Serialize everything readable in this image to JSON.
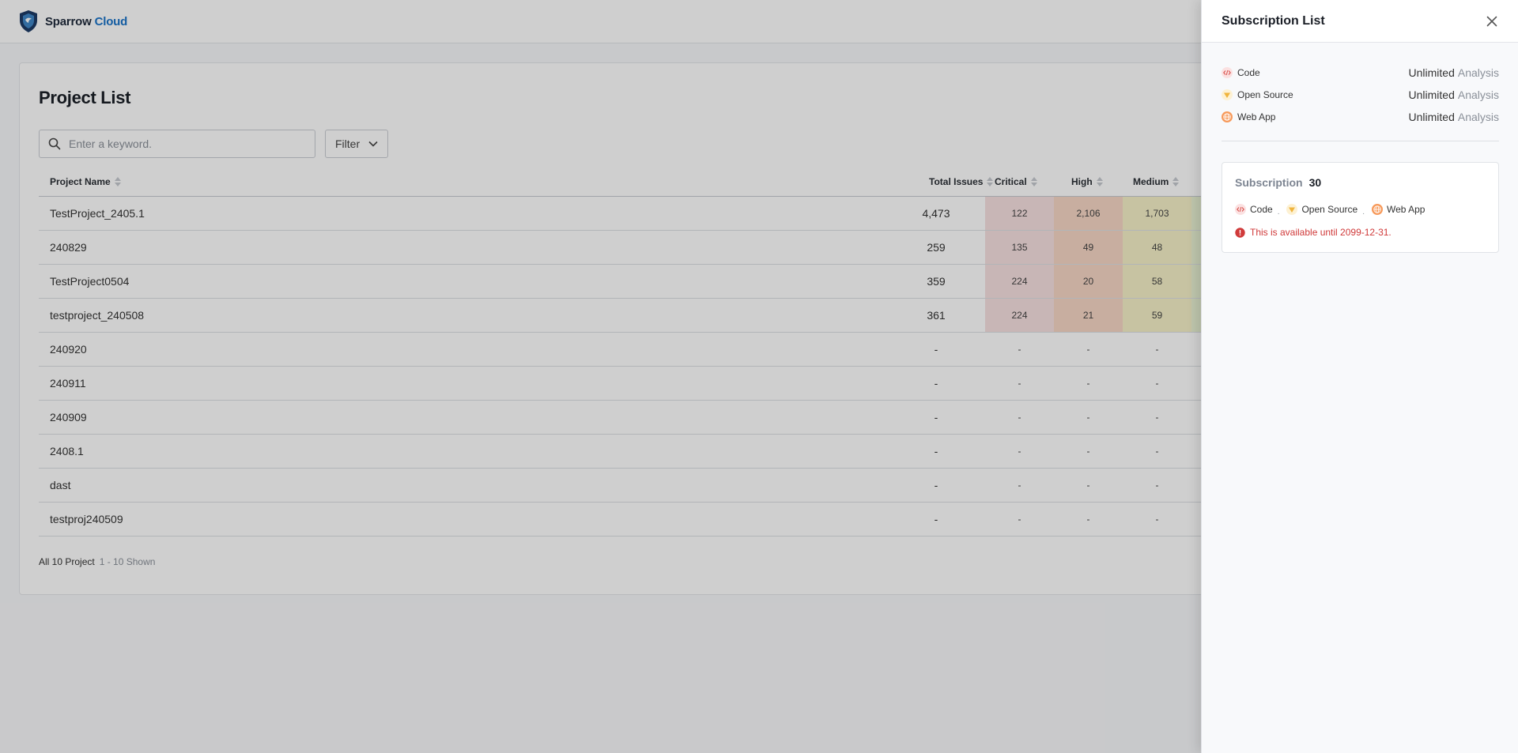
{
  "app": {
    "brand_main": "Sparrow",
    "brand_accent": "Cloud",
    "brand_color": "#1a73c8"
  },
  "project_list": {
    "title": "Project List",
    "search_placeholder": "Enter a keyword.",
    "filter_label": "Filter",
    "columns": {
      "name": "Project Name",
      "total": "Total Issues",
      "critical": "Critical",
      "high": "High",
      "medium": "Medium"
    },
    "rows": [
      {
        "name": "TestProject_2405.1",
        "total": "4,473",
        "critical": "122",
        "high": "2,106",
        "medium": "1,703",
        "has_data": true
      },
      {
        "name": "240829",
        "total": "259",
        "critical": "135",
        "high": "49",
        "medium": "48",
        "has_data": true
      },
      {
        "name": "TestProject0504",
        "total": "359",
        "critical": "224",
        "high": "20",
        "medium": "58",
        "has_data": true
      },
      {
        "name": "testproject_240508",
        "total": "361",
        "critical": "224",
        "high": "21",
        "medium": "59",
        "has_data": true
      },
      {
        "name": "240920",
        "total": "-",
        "critical": "-",
        "high": "-",
        "medium": "-",
        "has_data": false
      },
      {
        "name": "240911",
        "total": "-",
        "critical": "-",
        "high": "-",
        "medium": "-",
        "has_data": false
      },
      {
        "name": "240909",
        "total": "-",
        "critical": "-",
        "high": "-",
        "medium": "-",
        "has_data": false
      },
      {
        "name": "2408.1",
        "total": "-",
        "critical": "-",
        "high": "-",
        "medium": "-",
        "has_data": false
      },
      {
        "name": "dast",
        "total": "-",
        "critical": "-",
        "high": "-",
        "medium": "-",
        "has_data": false
      },
      {
        "name": "testproj240509",
        "total": "-",
        "critical": "-",
        "high": "-",
        "medium": "-",
        "has_data": false
      }
    ],
    "footer_total": "All 10 Project",
    "footer_range": "1 - 10 Shown"
  },
  "drawer": {
    "title": "Subscription List",
    "items": [
      {
        "label": "Code",
        "value": "Unlimited",
        "unit": "Analysis",
        "icon": "code-icon"
      },
      {
        "label": "Open Source",
        "value": "Unlimited",
        "unit": "Analysis",
        "icon": "open-source-icon"
      },
      {
        "label": "Web App",
        "value": "Unlimited",
        "unit": "Analysis",
        "icon": "web-app-icon"
      }
    ],
    "box": {
      "label": "Subscription",
      "count": "30",
      "types": [
        "Code",
        "Open Source",
        "Web App"
      ],
      "note": "This is available until 2099-12-31."
    }
  }
}
